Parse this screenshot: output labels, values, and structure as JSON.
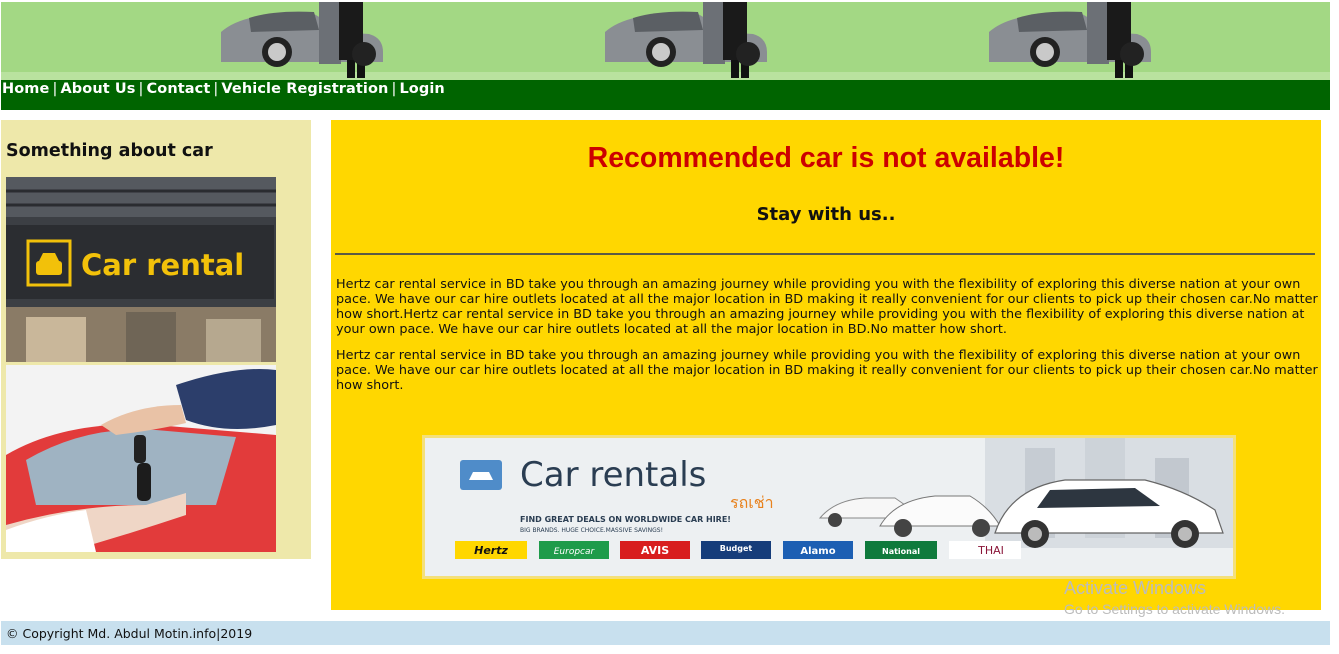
{
  "nav": {
    "home": "Home",
    "about": "About Us",
    "contact": "Contact",
    "vehicle_registration": "Vehicle Registration",
    "login": "Login",
    "separator": "|"
  },
  "sidebar": {
    "heading": "Something about car",
    "sign_text": "Car rental"
  },
  "main": {
    "title": "Recommended car is not available!",
    "subtitle": "Stay with us..",
    "paragraph_1": "Hertz car rental service in BD take you through an amazing journey while providing you with the flexibility of exploring this diverse nation at your own pace. We have our car hire outlets located at all the major location in BD making it really convenient for our clients to pick up their chosen car.No matter how short.Hertz car rental service in BD take you through an amazing journey while providing you with the flexibility of exploring this diverse nation at your own pace. We have our car hire outlets located at all the major location in BD.No matter how short.",
    "paragraph_2": "Hertz car rental service in BD take you through an amazing journey while providing you with the flexibility of exploring this diverse nation at your own pace. We have our car hire outlets located at all the major location in BD making it really convenient for our clients to pick up their chosen car.No matter how short."
  },
  "ad": {
    "headline": "Car rentals",
    "thai": "รถเช่า",
    "tagline": "FIND GREAT DEALS ON WORLDWIDE CAR HIRE!",
    "subtagline": "BIG BRANDS. HUGE CHOICE.MASSIVE SAVINGS!",
    "brands": [
      "Hertz",
      "Europcar",
      "AVIS",
      "Budget",
      "Alamo",
      "National",
      "THAI"
    ]
  },
  "watermark": {
    "line1": "Activate Windows",
    "line2": "Go to Settings to activate Windows."
  },
  "footer": {
    "copyright": "© Copyright Md. Abdul Motin.info|2019"
  },
  "colors": {
    "banner_green": "#a3d884",
    "nav_green": "#006400",
    "sidebar_bg": "#eee8aa",
    "main_bg": "#ffd700",
    "title_red": "#cc0000",
    "footer_bg": "#c8e0ee"
  }
}
